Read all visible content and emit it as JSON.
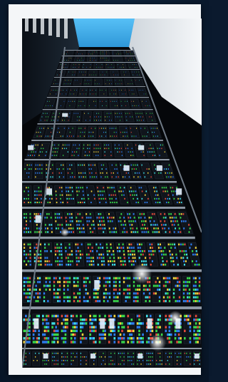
{
  "image": {
    "subject": "server-racks-perspective",
    "colors": {
      "frame": "#f4f6f8",
      "sky": "#39a8e8",
      "rack_dark": "#0a0d12",
      "rack_rail": "#8d97a3",
      "led_green": "#38d94a",
      "led_blue": "#2d7df0",
      "led_yellow": "#f2d43a",
      "led_cyan": "#3fe0e8",
      "wall": "#e9edf0"
    }
  }
}
